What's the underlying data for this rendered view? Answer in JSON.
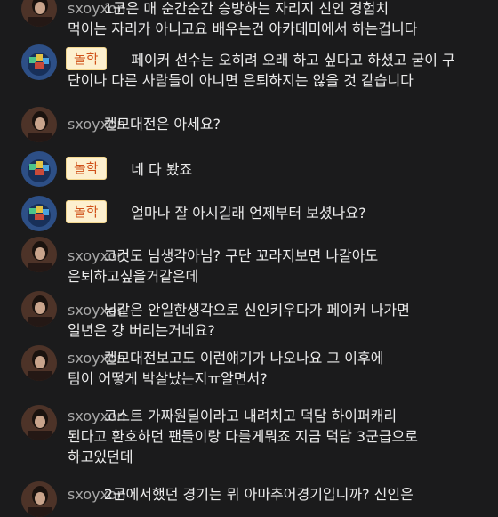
{
  "chat": {
    "messages": [
      {
        "type": "user",
        "nickname": "sxoyxon",
        "text": "        1군은 매 순간순간 승방하는 자리지 신인 경험치\n먹이는 자리가 아니고요 배우는건 아카데미에서 하는겁니다"
      },
      {
        "type": "badge",
        "badge": "놀학",
        "text": "              페이커 선수는 오히려 오래 하고 싶다고 하셨고 굳이 구\n단이나 다른 사람들이 아니면 은퇴하지는 않을 것 같습니다"
      },
      {
        "type": "user",
        "nickname": "sxoyxon",
        "text": "        켈모대전은 아세요?"
      },
      {
        "type": "badge",
        "badge": "놀학",
        "text": "              네 다 봤죠"
      },
      {
        "type": "badge",
        "badge": "놀학",
        "text": "              얼마나 잘 아시길래 언제부터 보셨나요?"
      },
      {
        "type": "user",
        "nickname": "sxoyxon",
        "text": "        그것도 님생각아님? 구단 꼬라지보면 나갈아도\n은퇴하고싶을거같은데"
      },
      {
        "type": "user",
        "nickname": "sxoyxon",
        "text": "        님같은 안일한생각으로 신인키우다가 페이커 나가면\n일년은 걍 버리는거네요?"
      },
      {
        "type": "user",
        "nickname": "sxoyxon",
        "text": "        켈모대전보고도 이런얘기가 나오나요 그 이후에\n팀이 어떻게 박살났는지ㅠ알면서?"
      },
      {
        "type": "user",
        "nickname": "sxoyxon",
        "text": "        고스트 가짜원딜이라고 내려치고 덕담 하이퍼캐리\n된다고 환호하던 팬들이랑 다를게뭐죠 지금 덕담 3군급으로\n하고있던데"
      },
      {
        "type": "user",
        "nickname": "sxoyxon",
        "text": "        2군에서했던 경기는 뭐 아마추어경기입니까? 신인은"
      }
    ]
  }
}
